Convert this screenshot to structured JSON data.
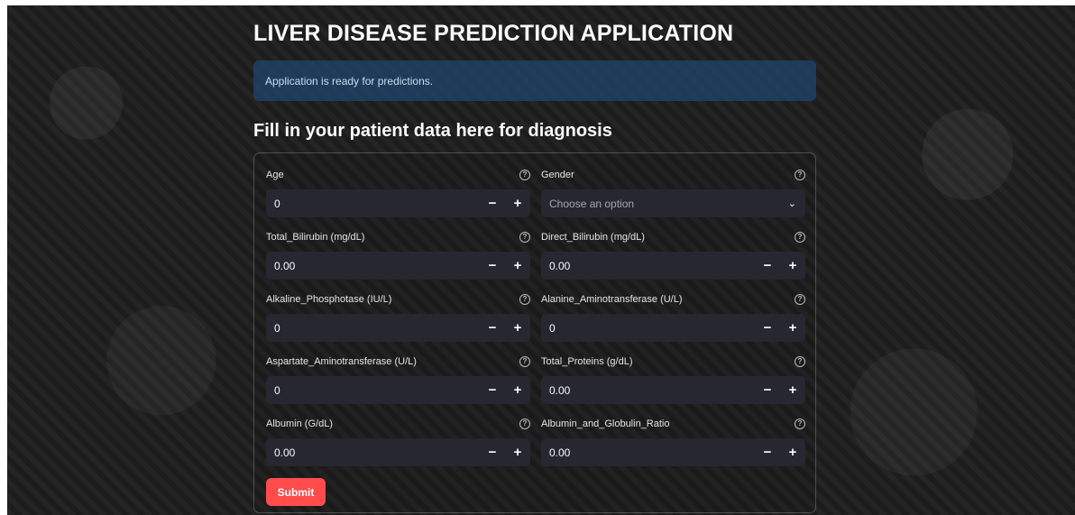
{
  "app": {
    "title": "LIVER DISEASE PREDICTION APPLICATION",
    "info_message": "Application is ready for predictions.",
    "section_title": "Fill in your patient data here for diagnosis"
  },
  "form": {
    "age": {
      "label": "Age",
      "value": "0"
    },
    "gender": {
      "label": "Gender",
      "placeholder": "Choose an option"
    },
    "total_bilirubin": {
      "label": "Total_Bilirubin (mg/dL)",
      "value": "0.00"
    },
    "direct_bilirubin": {
      "label": "Direct_Bilirubin (mg/dL)",
      "value": "0.00"
    },
    "alkaline_phosphotase": {
      "label": "Alkaline_Phosphotase (IU/L)",
      "value": "0"
    },
    "alanine_aminotransferase": {
      "label": "Alanine_Aminotransferase (U/L)",
      "value": "0"
    },
    "aspartate_aminotransferase": {
      "label": "Aspartate_Aminotransferase (U/L)",
      "value": "0"
    },
    "total_proteins": {
      "label": "Total_Proteins (g/dL)",
      "value": "0.00"
    },
    "albumin": {
      "label": "Albumin (G/dL)",
      "value": "0.00"
    },
    "albumin_globulin_ratio": {
      "label": "Albumin_and_Globulin_Ratio",
      "value": "0.00"
    },
    "submit_label": "Submit"
  },
  "icons": {
    "help": "question-circle-icon",
    "minus": "minus-icon",
    "plus": "plus-icon",
    "dropdown": "chevron-down-icon"
  },
  "colors": {
    "primary": "#ff4b4b",
    "input_bg": "#262730",
    "info_bg": "#1e466e"
  }
}
